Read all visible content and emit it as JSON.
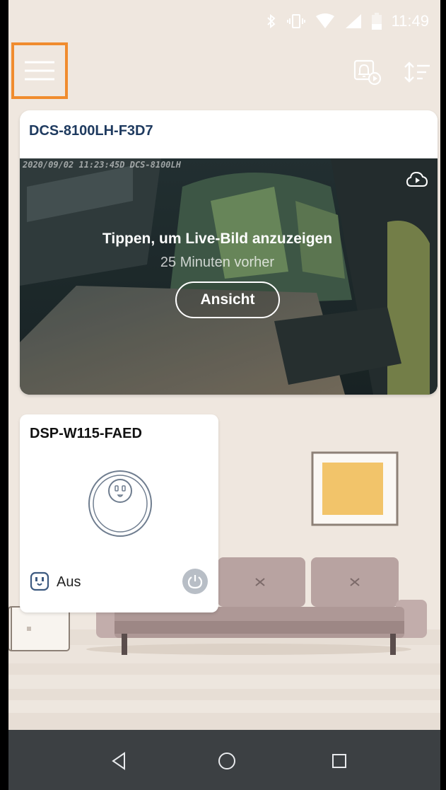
{
  "status_bar": {
    "time": "11:49",
    "icons": [
      "bluetooth-icon",
      "vibrate-icon",
      "wifi-icon",
      "signal-icon",
      "battery-icon"
    ]
  },
  "app_bar": {
    "icons": [
      "menu-icon",
      "event-playback-icon",
      "sort-icon"
    ],
    "colors": {
      "menu_highlight": "#f08c2e"
    }
  },
  "camera_card": {
    "title": "DCS-8100LH-F3D7",
    "timestamp": "2020/09/02 11:23:45D DCS-8100LH",
    "live_prompt": "Tippen, um Live-Bild anzuzeigen",
    "time_ago": "25 Minuten vorher",
    "view_label": "Ansicht",
    "icons": [
      "cloud-play-icon"
    ],
    "colors": {
      "title": "#1e3a5f"
    }
  },
  "plug_card": {
    "title": "DSP-W115-FAED",
    "status": "Aus",
    "icons": [
      "smart-plug-icon",
      "outlet-icon",
      "power-icon"
    ]
  },
  "nav_bar": {
    "icons": [
      "back-icon",
      "home-icon",
      "recents-icon"
    ]
  }
}
